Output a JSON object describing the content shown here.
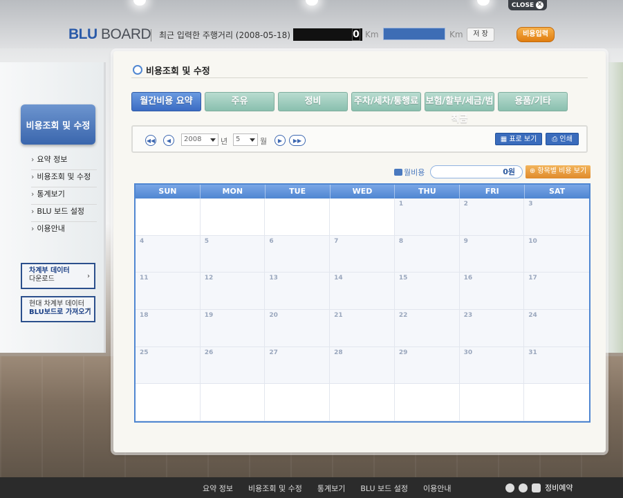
{
  "header": {
    "close_label": "CLOSE",
    "logo_blu": "BLU",
    "logo_board": "BOARD",
    "last_mileage_label": "최근 입력한 주행거리 (2008-05-18) :",
    "odometer_value": "0",
    "km_unit": "Km",
    "km_input_value": "",
    "save_label": "저 장",
    "cost_input_label": "비용입력"
  },
  "sidebar": {
    "title": "비용조회 및 수정",
    "items": [
      "요약 정보",
      "비용조회 및 수정",
      "통계보기",
      "BLU 보드 설정",
      "이용안내"
    ],
    "download_box": {
      "line1": "차계부 데이터",
      "line2": "다운로드"
    },
    "import_box": {
      "line1": "현대 차계부 데이터",
      "line2": "BLU보드로 가져오기"
    }
  },
  "main": {
    "page_title": "비용조회 및 수정",
    "tabs": [
      "월간비용 요약",
      "주유",
      "정비",
      "주차/세차/통행료",
      "보험/할부/세금/범칙금",
      "용품/기타"
    ],
    "active_tab": 0,
    "year_value": "2008",
    "year_unit": "년",
    "month_value": "5",
    "month_unit": "월",
    "table_view_label": "표로 보기",
    "print_label": "인쇄",
    "monthly_cost_label": "월비용",
    "monthly_cost_value": "0원",
    "item_cost_label": "항목별 비용 보기"
  },
  "calendar": {
    "weekdays": [
      "SUN",
      "MON",
      "TUE",
      "WED",
      "THU",
      "FRI",
      "SAT"
    ],
    "cells": [
      "",
      "",
      "",
      "",
      "1",
      "2",
      "3",
      "4",
      "5",
      "6",
      "7",
      "8",
      "9",
      "10",
      "11",
      "12",
      "13",
      "14",
      "15",
      "16",
      "17",
      "18",
      "19",
      "20",
      "21",
      "22",
      "23",
      "24",
      "25",
      "26",
      "27",
      "28",
      "29",
      "30",
      "31",
      "",
      "",
      "",
      "",
      "",
      "",
      ""
    ]
  },
  "footer": {
    "nav": [
      "요약 정보",
      "비용조회 및 수정",
      "통계보기",
      "BLU 보드 설정",
      "이용안내"
    ],
    "service_label": "정비예약"
  }
}
